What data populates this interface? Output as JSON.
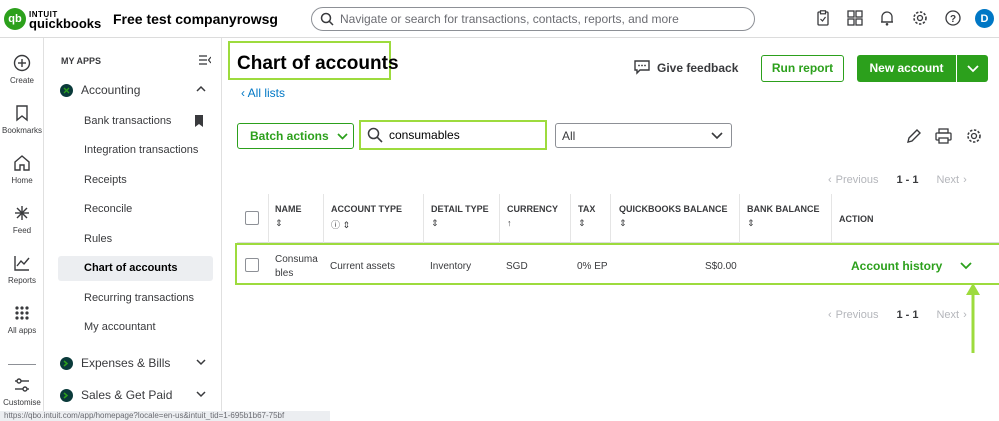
{
  "topbar": {
    "brand_line1": "INTUIT",
    "brand_line2": "quickbooks",
    "company_name": "Free test companyrowsg",
    "search_placeholder": "Navigate or search for transactions, contacts, reports, and more",
    "avatar_initial": "D"
  },
  "rail": {
    "items": [
      {
        "label": "Create"
      },
      {
        "label": "Bookmarks"
      },
      {
        "label": "Home"
      },
      {
        "label": "Feed"
      },
      {
        "label": "Reports"
      },
      {
        "label": "All apps"
      },
      {
        "label": "Customise"
      }
    ]
  },
  "menu": {
    "header": "MY APPS",
    "accounting": {
      "label": "Accounting",
      "items": [
        {
          "label": "Bank transactions"
        },
        {
          "label": "Integration transactions"
        },
        {
          "label": "Receipts"
        },
        {
          "label": "Reconcile"
        },
        {
          "label": "Rules"
        },
        {
          "label": "Chart of accounts"
        },
        {
          "label": "Recurring transactions"
        },
        {
          "label": "My accountant"
        }
      ]
    },
    "expenses": {
      "label": "Expenses & Bills"
    },
    "sales": {
      "label": "Sales & Get Paid"
    }
  },
  "page": {
    "title": "Chart of accounts",
    "all_lists": "All lists",
    "give_feedback": "Give feedback",
    "run_report": "Run report",
    "new_account": "New account",
    "batch_actions": "Batch actions",
    "search_value": "consumables",
    "filter_value": "All"
  },
  "pager": {
    "previous": "Previous",
    "range": "1 - 1",
    "next": "Next"
  },
  "table": {
    "headers": {
      "name": "NAME",
      "account_type": "ACCOUNT TYPE",
      "detail_type": "DETAIL TYPE",
      "currency": "CURRENCY",
      "tax": "TAX",
      "qb_balance": "QUICKBOOKS BALANCE",
      "bank_balance": "BANK BALANCE",
      "action": "ACTION"
    },
    "rows": [
      {
        "name_line1": "Consuma",
        "name_line2": "bles",
        "account_type": "Current assets",
        "detail_type": "Inventory",
        "currency": "SGD",
        "tax": "0% EP",
        "qb_balance": "S$0.00",
        "bank_balance": "",
        "action": "Account history"
      }
    ]
  },
  "status_url": "https://qbo.intuit.com/app/homepage?locale=en-us&intuit_tid=1-695b1b67-75bf",
  "colors": {
    "brand_green": "#2ca01c",
    "highlight": "#9ddb3d",
    "link_blue": "#0077c5"
  }
}
